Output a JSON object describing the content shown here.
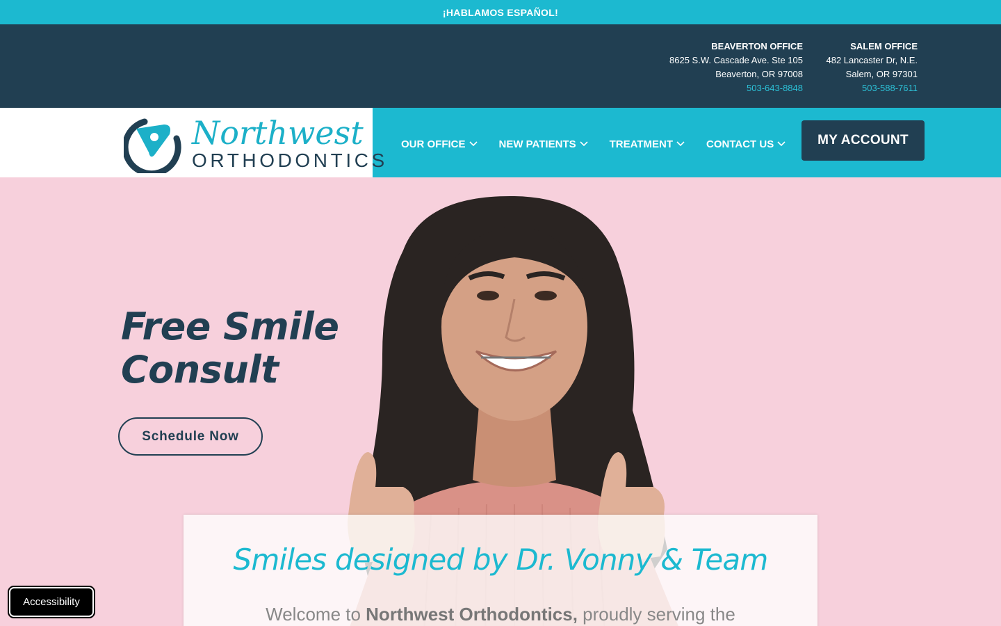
{
  "topbar": {
    "text": "¡HABLAMOS ESPAÑOL!"
  },
  "offices": [
    {
      "name": "BEAVERTON OFFICE",
      "address1": "8625 S.W. Cascade Ave. Ste 105",
      "address2": "Beaverton, OR 97008",
      "phone": "503-643-8848"
    },
    {
      "name": "SALEM OFFICE",
      "address1": "482 Lancaster Dr, N.E.",
      "address2": "Salem, OR 97301",
      "phone": "503-588-7611"
    }
  ],
  "logo": {
    "word1": "Northwest",
    "word2": "ORTHODONTICS"
  },
  "nav": {
    "items": [
      {
        "label": "OUR OFFICE"
      },
      {
        "label": "NEW PATIENTS"
      },
      {
        "label": "TREATMENT"
      },
      {
        "label": "CONTACT US"
      }
    ],
    "account_label": "MY ACCOUNT"
  },
  "hero": {
    "title_line1": "Free Smile",
    "title_line2": "Consult",
    "cta_label": "Schedule Now"
  },
  "welcome": {
    "heading": "Smiles designed by Dr. Vonny & Team",
    "text_prefix": "Welcome to ",
    "text_bold": "Northwest Orthodontics,",
    "text_suffix": " proudly serving the"
  },
  "accessibility": {
    "label": "Accessibility"
  },
  "colors": {
    "teal": "#1cb9d0",
    "navy": "#213f52",
    "pink": "#f7d0dc"
  }
}
